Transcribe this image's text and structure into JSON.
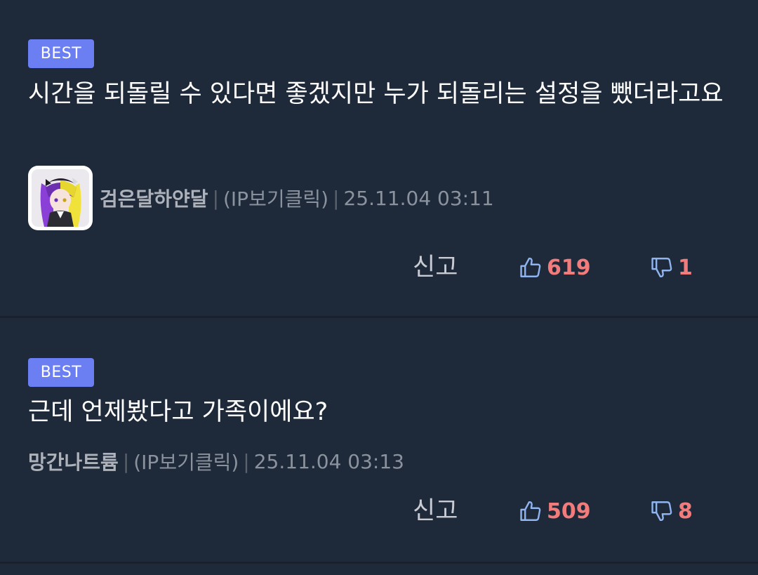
{
  "comments": [
    {
      "badge": "BEST",
      "text": "시간을 되돌릴 수 있다면 좋겠지만 누가 되돌리는 설정을 뺐더라고요",
      "nickname": "검은달하얀달",
      "ip": "(IP보기클릭)",
      "timestamp": "25.11.04 03:11",
      "report_label": "신고",
      "likes": "619",
      "dislikes": "1",
      "has_avatar": true
    },
    {
      "badge": "BEST",
      "text": "근데 언제봤다고 가족이에요?",
      "nickname": "망간나트륨",
      "ip": "(IP보기클릭)",
      "timestamp": "25.11.04 03:13",
      "report_label": "신고",
      "likes": "509",
      "dislikes": "8",
      "has_avatar": false
    }
  ],
  "colors": {
    "background": "#1e2939",
    "badge": "#6c7ff2",
    "vote_count": "#f27c7c",
    "thumb_icon": "#8fb4f0"
  },
  "icons": {
    "like": "thumbs-up-icon",
    "dislike": "thumbs-down-icon"
  }
}
